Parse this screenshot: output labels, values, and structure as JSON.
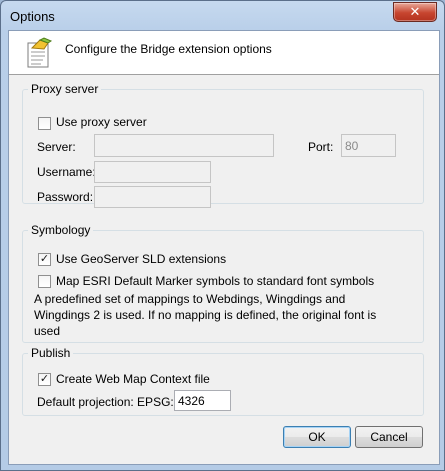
{
  "window": {
    "title": "Options",
    "close_glyph": "✕"
  },
  "header": {
    "text": "Configure the Bridge extension options",
    "icon": "settings-document-icon"
  },
  "proxy": {
    "legend": "Proxy server",
    "use_proxy_label": "Use proxy server",
    "use_proxy_checked": false,
    "server_label": "Server:",
    "server_value": "",
    "port_label": "Port:",
    "port_value": "80",
    "username_label": "Username:",
    "username_value": "",
    "password_label": "Password:",
    "password_value": ""
  },
  "symbology": {
    "legend": "Symbology",
    "sld_label": "Use GeoServer SLD extensions",
    "sld_checked": true,
    "map_esri_label": "Map ESRI Default Marker symbols to standard font symbols",
    "map_esri_checked": false,
    "description": "A predefined set of mappings to Webdings, Wingdings and Wingdings 2 is used. If no mapping is defined, the original font is used"
  },
  "publish": {
    "legend": "Publish",
    "wmc_label": "Create Web Map Context file",
    "wmc_checked": true,
    "projection_label": "Default projection: EPSG:",
    "projection_value": "4326"
  },
  "buttons": {
    "ok": "OK",
    "cancel": "Cancel"
  },
  "colors": {
    "frame": "#b4cbe6",
    "close_button": "#c7452f",
    "client": "#f0f0f0"
  }
}
